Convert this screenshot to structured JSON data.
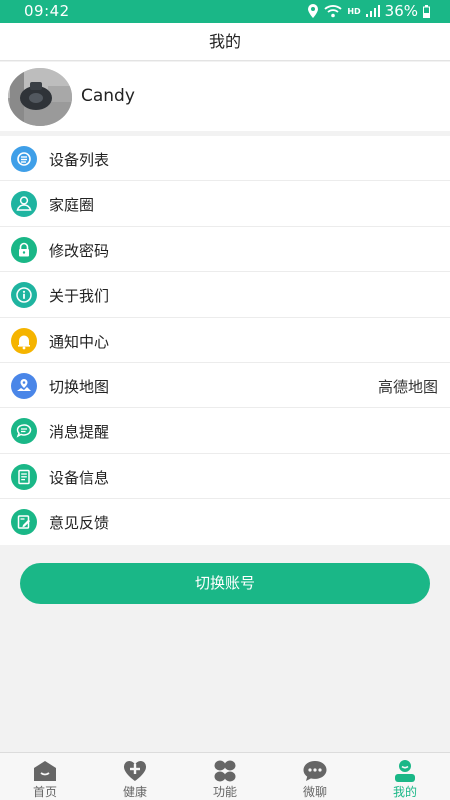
{
  "status_bar": {
    "time": "09:42",
    "hd": "HD",
    "battery": "36%"
  },
  "header": {
    "title": "我的"
  },
  "profile": {
    "name": "Candy"
  },
  "menu": [
    {
      "label": "设备列表",
      "icon": "device-list-icon",
      "color": "#3f9fe8"
    },
    {
      "label": "家庭圈",
      "icon": "family-icon",
      "color": "#1fb4a0"
    },
    {
      "label": "修改密码",
      "icon": "lock-icon",
      "color": "#1ab787"
    },
    {
      "label": "关于我们",
      "icon": "info-icon",
      "color": "#1fb4a0"
    },
    {
      "label": "通知中心",
      "icon": "bell-icon",
      "color": "#f5b400"
    },
    {
      "label": "切换地图",
      "icon": "map-icon",
      "color": "#4a86e8",
      "value": "高德地图"
    },
    {
      "label": "消息提醒",
      "icon": "message-icon",
      "color": "#1ab787"
    },
    {
      "label": "设备信息",
      "icon": "document-icon",
      "color": "#1ab787"
    },
    {
      "label": "意见反馈",
      "icon": "feedback-icon",
      "color": "#1ab787"
    }
  ],
  "switch_account_label": "切换账号",
  "tabs": [
    {
      "label": "首页",
      "icon": "home-icon",
      "active": false
    },
    {
      "label": "健康",
      "icon": "health-icon",
      "active": false
    },
    {
      "label": "功能",
      "icon": "functions-icon",
      "active": false
    },
    {
      "label": "微聊",
      "icon": "chat-icon",
      "active": false
    },
    {
      "label": "我的",
      "icon": "profile-icon",
      "active": true
    }
  ],
  "colors": {
    "accent": "#1ab787",
    "inactive_tab": "#666666"
  }
}
